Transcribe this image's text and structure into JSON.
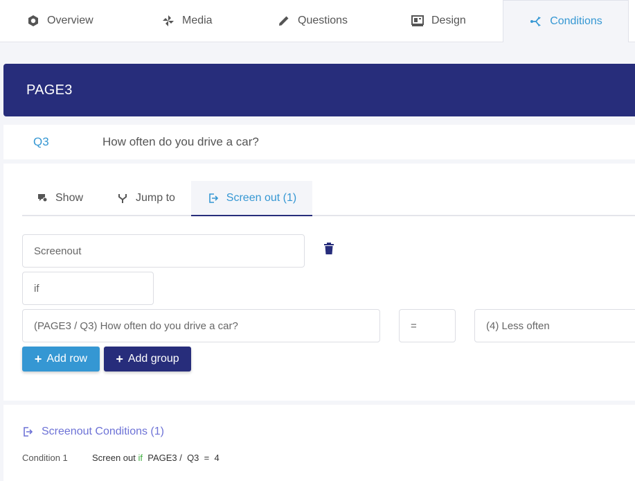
{
  "top_tabs": [
    {
      "label": "Overview",
      "icon": "hexagon-icon"
    },
    {
      "label": "Media",
      "icon": "pinwheel-icon"
    },
    {
      "label": "Questions",
      "icon": "pencil-icon"
    },
    {
      "label": "Design",
      "icon": "design-icon"
    },
    {
      "label": "Conditions",
      "icon": "branch-icon",
      "active": true
    }
  ],
  "page": {
    "title": "PAGE3"
  },
  "question": {
    "id": "Q3",
    "text": "How often do you drive a car?"
  },
  "condition_tabs": [
    {
      "label": "Show",
      "icon": "show-icon"
    },
    {
      "label": "Jump to",
      "icon": "fork-icon"
    },
    {
      "label": "Screen out (1)",
      "icon": "screen-out-icon",
      "active": true
    }
  ],
  "rule": {
    "name_value": "Screenout",
    "if_value": "if",
    "question_value": "(PAGE3 / Q3) How often do you drive a car?",
    "operator_value": "=",
    "answer_value": "(4) Less often"
  },
  "buttons": {
    "add_row": "Add row",
    "add_group": "Add group"
  },
  "summary": {
    "title": "Screenout Conditions (1)",
    "condition_label": "Condition 1",
    "action": "Screen out",
    "keyword": "if",
    "reference": "PAGE3 /  Q3",
    "operator": "=",
    "value": "4"
  },
  "colors": {
    "accent": "#3597d3",
    "navy": "#272d7b",
    "keyword_green": "#3fae3f",
    "summary_title": "#6d72d6"
  }
}
